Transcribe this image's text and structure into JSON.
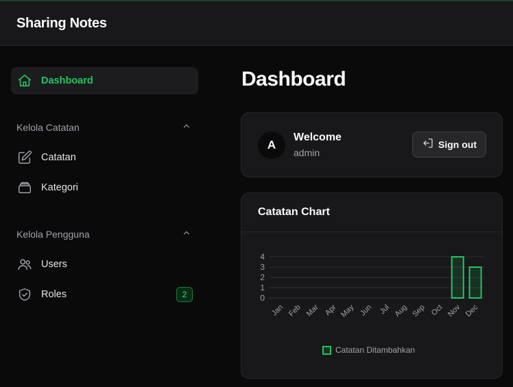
{
  "app": {
    "title": "Sharing Notes"
  },
  "sidebar": {
    "dashboard": {
      "label": "Dashboard",
      "icon": "home-icon"
    },
    "sections": [
      {
        "label": "Kelola Catatan",
        "items": [
          {
            "label": "Catatan",
            "icon": "edit-icon"
          },
          {
            "label": "Kategori",
            "icon": "archive-icon"
          }
        ]
      },
      {
        "label": "Kelola Pengguna",
        "items": [
          {
            "label": "Users",
            "icon": "users-icon"
          },
          {
            "label": "Roles",
            "icon": "shield-icon",
            "badge": "2"
          }
        ]
      }
    ]
  },
  "main": {
    "page_title": "Dashboard",
    "welcome": {
      "avatar": "A",
      "title": "Welcome",
      "subtitle": "admin",
      "signout_label": "Sign out"
    },
    "chart_card": {
      "title": "Catatan Chart"
    }
  },
  "colors": {
    "accent": "#22c55e",
    "background": "#0a0a0b",
    "card": "#18181b"
  },
  "chart_data": {
    "type": "bar",
    "categories": [
      "Jan",
      "Feb",
      "Mar",
      "Apr",
      "May",
      "Jun",
      "Jul",
      "Aug",
      "Sep",
      "Oct",
      "Nov",
      "Dec"
    ],
    "series": [
      {
        "name": "Catatan Ditambahkan",
        "values": [
          0,
          0,
          0,
          0,
          0,
          0,
          0,
          0,
          0,
          0,
          4,
          3
        ]
      }
    ],
    "yticks": [
      0,
      1,
      2,
      3,
      4
    ],
    "ylim": [
      0,
      4
    ],
    "grid": true,
    "legend": "bottom"
  }
}
